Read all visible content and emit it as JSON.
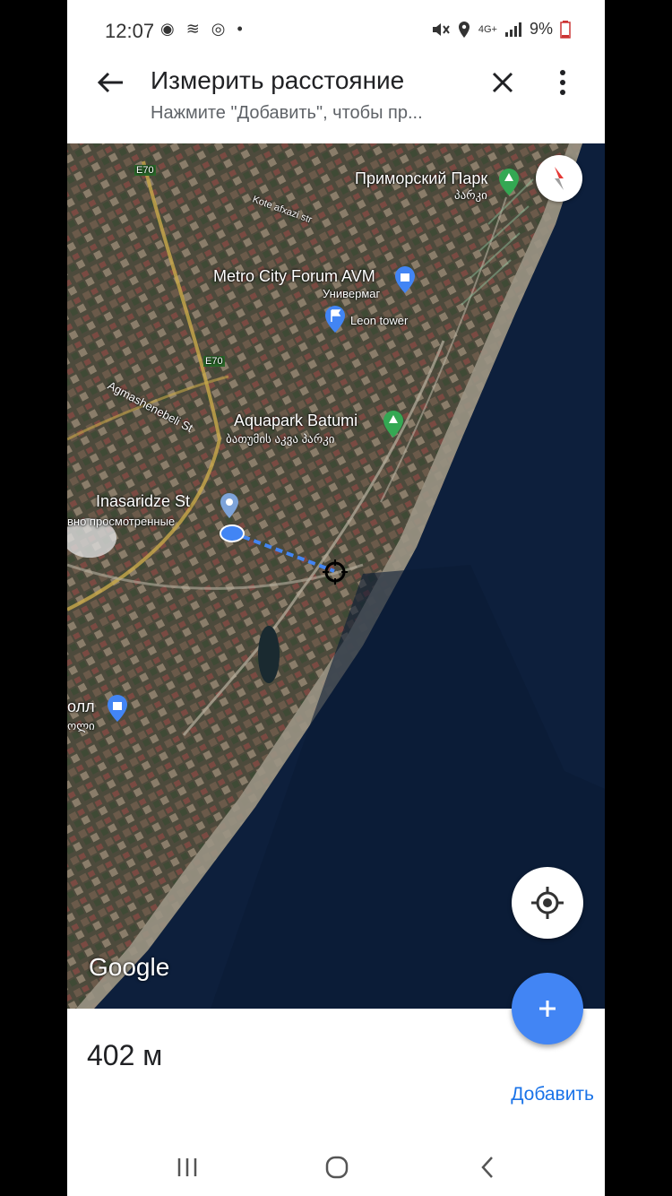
{
  "status": {
    "time": "12:07",
    "left_icons": "◉ ≋ ◎ •",
    "network": "4G+",
    "battery": "9%"
  },
  "header": {
    "title": "Измерить расстояние",
    "subtitle": "Нажмите \"Добавить\", чтобы пр..."
  },
  "map": {
    "labels": {
      "primorsky": "Приморский Парк",
      "primorsky_geo": "პარკი",
      "kote": "Kote afxazi str",
      "metro": "Metro City Forum AVM",
      "univermag": "Универмаг",
      "leon": "Leon tower",
      "e70_top": "E70",
      "e70_mid": "E70",
      "agmash": "Agmashenebeli St",
      "aquapark": "Aquapark Batumi",
      "aquapark_geo": "ბათუმის აკვა პარკი",
      "inasaridze": "Inasaridze St",
      "recent": "вно просмотренные",
      "mall_ru": "олл",
      "mall_geo": "ოლი"
    },
    "google": "Google"
  },
  "measure": {
    "distance": "402 м",
    "add_label": "Добавить"
  },
  "colors": {
    "accent": "#4285f4",
    "link": "#1a73e8",
    "sea": "#0d1f3c",
    "land": "#5a5245"
  }
}
